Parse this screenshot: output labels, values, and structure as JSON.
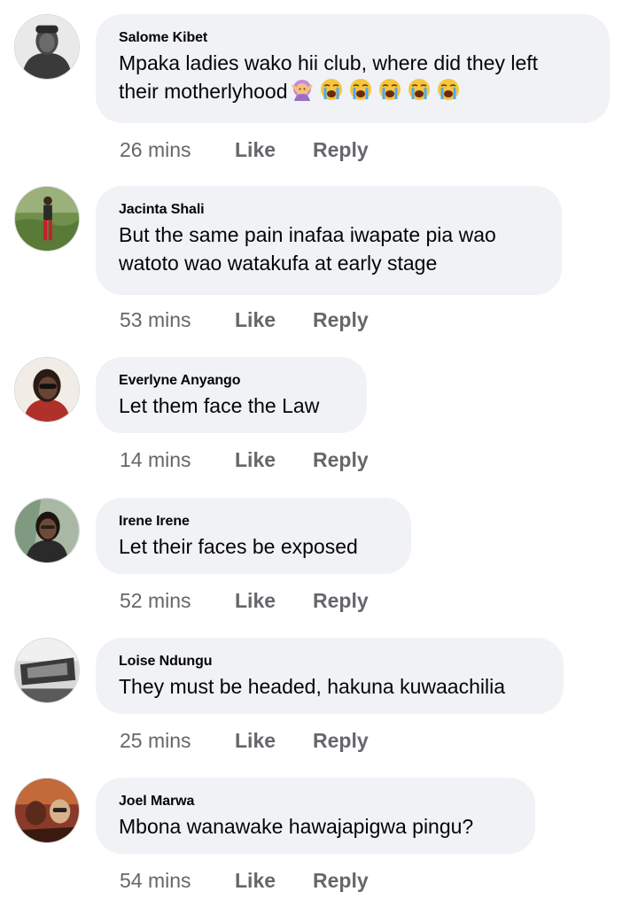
{
  "actions": {
    "like_label": "Like",
    "reply_label": "Reply"
  },
  "colors": {
    "bubble_bg": "#f0f2f5",
    "secondary_text": "#65676b",
    "primary_text": "#050505"
  },
  "comments": [
    {
      "author": "Salome Kibet",
      "line1": "Mpaka ladies wako hii club, where did they left",
      "line2": "their motherlyhood",
      "emojis": [
        "woman-gesturing-no-emoji",
        "loudly-crying-face-emoji",
        "loudly-crying-face-emoji",
        "loudly-crying-face-emoji",
        "loudly-crying-face-emoji",
        "loudly-crying-face-emoji"
      ],
      "time": "26 mins"
    },
    {
      "author": "Jacinta Shali",
      "line1": "But the same pain inafaa iwapate pia wao",
      "line2": "watoto wao watakufa at early stage",
      "time": "53 mins"
    },
    {
      "author": "Everlyne Anyango",
      "line1": "Let them face the Law",
      "time": "14 mins"
    },
    {
      "author": "Irene Irene",
      "line1": "Let their faces be exposed",
      "time": "52 mins"
    },
    {
      "author": "Loise Ndungu",
      "line1": "They must be headed, hakuna kuwaachilia",
      "time": "25 mins"
    },
    {
      "author": "Joel Marwa",
      "line1": "Mbona wanawake hawajapigwa pingu?",
      "time": "54 mins"
    }
  ]
}
